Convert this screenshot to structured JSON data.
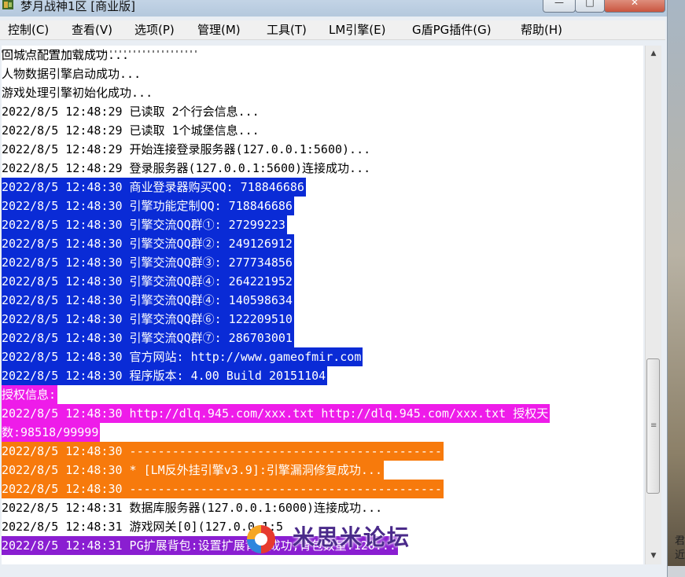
{
  "window": {
    "title": "梦月战神1区 [商业版]",
    "controls": {
      "minimize": "—",
      "maximize": "□",
      "close": "✕"
    }
  },
  "menu": {
    "items": [
      "控制(C)",
      "查看(V)",
      "选项(P)",
      "管理(M)",
      "工具(T)",
      "LM引擎(E)",
      "G盾PG插件(G)",
      "帮助(H)"
    ]
  },
  "log": {
    "lines": [
      {
        "text": "回城点配置加载成功...",
        "style": "plain"
      },
      {
        "text": "人物数据引擎启动成功...",
        "style": "plain"
      },
      {
        "text": "游戏处理引擎初始化成功...",
        "style": "plain"
      },
      {
        "text": "2022/8/5 12:48:29 已读取 2个行会信息...",
        "style": "plain"
      },
      {
        "text": "2022/8/5 12:48:29 已读取 1个城堡信息...",
        "style": "plain"
      },
      {
        "text": "2022/8/5 12:48:29 开始连接登录服务器(127.0.0.1:5600)...",
        "style": "plain"
      },
      {
        "text": "2022/8/5 12:48:29 登录服务器(127.0.0.1:5600)连接成功...",
        "style": "plain"
      },
      {
        "text": "2022/8/5 12:48:30 商业登录器购买QQ: 718846686",
        "style": "blue"
      },
      {
        "text": "2022/8/5 12:48:30 引擎功能定制QQ: 718846686",
        "style": "blue"
      },
      {
        "text": "2022/8/5 12:48:30 引擎交流QQ群①: 27299223",
        "style": "blue"
      },
      {
        "text": "2022/8/5 12:48:30 引擎交流QQ群②: 249126912",
        "style": "blue"
      },
      {
        "text": "2022/8/5 12:48:30 引擎交流QQ群③: 277734856",
        "style": "blue"
      },
      {
        "text": "2022/8/5 12:48:30 引擎交流QQ群④: 264221952",
        "style": "blue"
      },
      {
        "text": "2022/8/5 12:48:30 引擎交流QQ群④: 140598634",
        "style": "blue"
      },
      {
        "text": "2022/8/5 12:48:30 引擎交流QQ群⑥: 122209510",
        "style": "blue"
      },
      {
        "text": "2022/8/5 12:48:30 引擎交流QQ群⑦: 286703001",
        "style": "blue"
      },
      {
        "text": "2022/8/5 12:48:30 官方网站: http://www.gameofmir.com",
        "style": "blue"
      },
      {
        "text": "2022/8/5 12:48:30 程序版本: 4.00 Build 20151104",
        "style": "blue"
      },
      {
        "text": "授权信息:",
        "style": "mag"
      },
      {
        "text": "2022/8/5 12:48:30 http://dlq.945.com/xxx.txt http://dlq.945.com/xxx.txt 授权天",
        "style": "mag"
      },
      {
        "text": "数:98518/99999",
        "style": "mag"
      },
      {
        "text": "2022/8/5 12:48:30 --------------------------------------------",
        "style": "org"
      },
      {
        "text": "2022/8/5 12:48:30 * [LM反外挂引擎v3.9]:引擎漏洞修复成功...",
        "style": "org"
      },
      {
        "text": "2022/8/5 12:48:30 --------------------------------------------",
        "style": "org"
      },
      {
        "text": "2022/8/5 12:48:31 数据库服务器(127.0.0.1:6000)连接成功...",
        "style": "plain"
      },
      {
        "text": "2022/8/5 12:48:31 游戏网关[0](127.0.0.1:5",
        "style": "plain"
      },
      {
        "text": "2022/8/5 12:48:31 PG扩展背包:设置扩展背包成功,背包数量:120...",
        "style": "pur"
      }
    ]
  },
  "scrollbar": {
    "up": "▲",
    "down": "▼",
    "grip": "≡"
  },
  "watermark": {
    "text": "米思米论坛"
  },
  "desktop": {
    "text": "君 近"
  }
}
